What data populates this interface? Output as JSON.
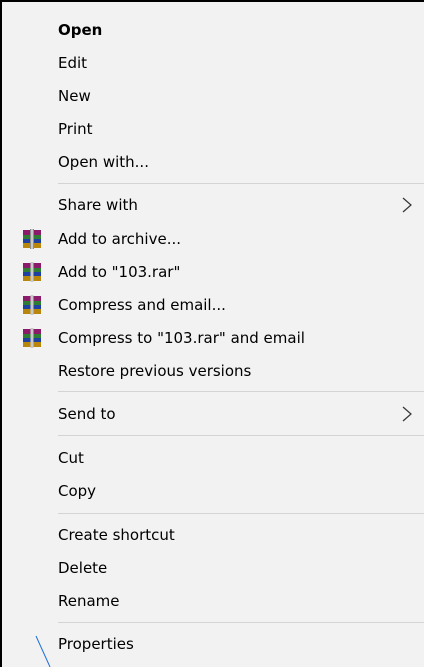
{
  "menu": {
    "items": [
      {
        "label": "Open",
        "bold": true
      },
      {
        "label": "Edit"
      },
      {
        "label": "New"
      },
      {
        "label": "Print"
      },
      {
        "label": "Open with..."
      },
      {
        "label": "Share with",
        "submenu": true
      },
      {
        "label": "Add to archive...",
        "icon": "winrar-icon"
      },
      {
        "label": "Add to \"103.rar\"",
        "icon": "winrar-icon"
      },
      {
        "label": "Compress and email...",
        "icon": "winrar-icon"
      },
      {
        "label": "Compress to \"103.rar\" and email",
        "icon": "winrar-icon"
      },
      {
        "label": "Restore previous versions"
      },
      {
        "label": "Send to",
        "submenu": true
      },
      {
        "label": "Cut"
      },
      {
        "label": "Copy"
      },
      {
        "label": "Create shortcut"
      },
      {
        "label": "Delete"
      },
      {
        "label": "Rename"
      },
      {
        "label": "Properties"
      }
    ]
  },
  "colors": {
    "menu_bg": "#f2f2f2",
    "separator": "#d4d4d4",
    "outer_bg": "#000000",
    "accent_line": "#1e6fd9"
  }
}
